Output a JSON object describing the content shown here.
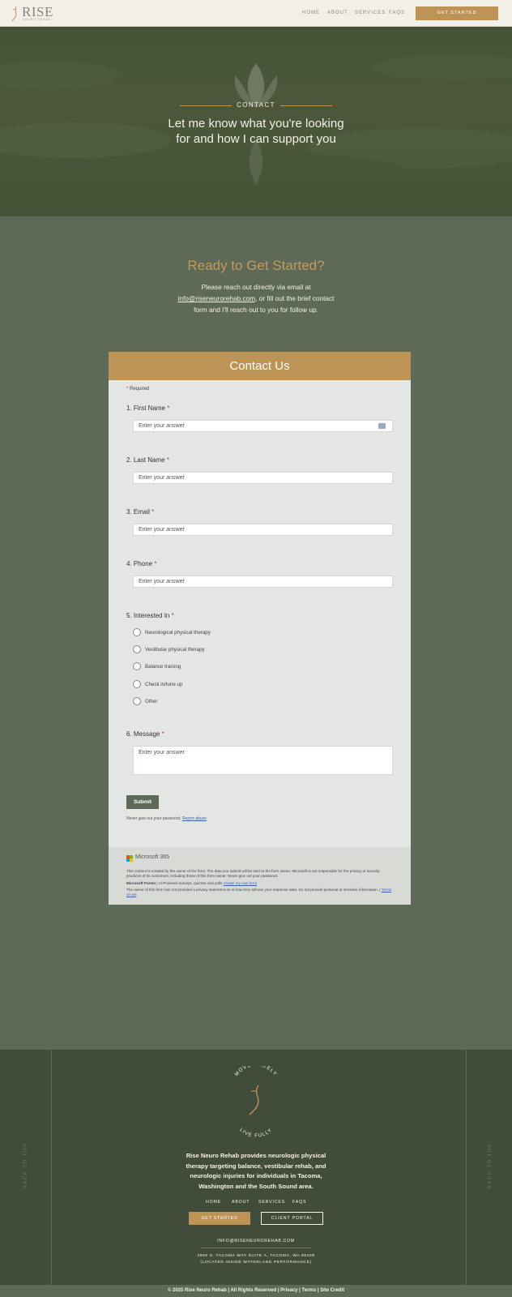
{
  "header": {
    "logo_text": "RISE",
    "logo_sub": "NEURO REHAB",
    "nav": [
      "HOME",
      "ABOUT",
      "SERVICES",
      "FAQS"
    ],
    "cta": "GET STARTED"
  },
  "hero": {
    "label": "CONTACT",
    "title_line1": "Let me know what you're looking",
    "title_line2": "for and how I can support you"
  },
  "intro": {
    "heading": "Ready to Get Started?",
    "text_line1": "Please reach out directly via email at",
    "email": "info@riseneurorehab.com",
    "text_line2_rest": ", or fill out the brief contact",
    "text_line3": "form and I'll reach out to you for follow up."
  },
  "form": {
    "title": "Contact Us",
    "required_star": "*",
    "required_note": "Required",
    "questions": [
      {
        "label": "1. First Name",
        "placeholder": "Enter your answer"
      },
      {
        "label": "2. Last Name",
        "placeholder": "Enter your answer"
      },
      {
        "label": "3. Email",
        "placeholder": "Enter your answer"
      },
      {
        "label": "4. Phone",
        "placeholder": "Enter your answer"
      },
      {
        "label": "5. Interested In"
      },
      {
        "label": "6. Message",
        "placeholder": "Enter your answer"
      }
    ],
    "options": [
      "Neurological physical therapy",
      "Vestibular physical therapy",
      "Balance training",
      "Check in/tune up",
      "Other"
    ],
    "submit": "Submit",
    "password_note": "Never give out your password.",
    "report": "Report abuse",
    "ms_brand": "Microsoft 365",
    "disclaimer1": "This content is created by the owner of the form. The data you submit will be sent to the form owner. Microsoft is not responsible for the privacy or security practices of its customers, including those of this form owner. Never give out your password.",
    "forms_bold": "Microsoft Forms",
    "forms_rest": " | AI-Powered surveys, quizzes and polls ",
    "create_link": "Create my own form",
    "disclaimer2": "The owner of this form has not provided a privacy statement as to how they will use your response data. Do not provide personal or sensitive information. | ",
    "terms": "Terms of use"
  },
  "footer": {
    "arc_top": "MOVE FREELY",
    "arc_bottom": "LIVE FULLY",
    "about": "Rise Neuro Rehab provides neurologic physical therapy targeting balance, vestibular rehab, and neurologic injuries for individuals in Tacoma, Washington and the South Sound area.",
    "nav": [
      "HOME",
      "ABOUT",
      "SERVICES",
      "FAQS"
    ],
    "btn_start": "GET STARTED",
    "btn_portal": "CLIENT PORTAL",
    "email": "INFO@RISENEUROREHAB.COM",
    "address_line1": "2965 S. TACOMA WAY SUITE A, TACOMA, WA 98409",
    "address_line2": "(LOCATED INSIDE WATERLAND PERFORMANCE)",
    "back_to_top": "BACK TO TOP",
    "copyright": "© 2025 Rise Neuro Rehab | All Rights Reserved | Privacy | Terms | Site Credit"
  },
  "colors": {
    "gold": "#be9356",
    "sage": "#5e6a58",
    "dark_green": "#424c3a",
    "cream": "#f1efe8"
  }
}
